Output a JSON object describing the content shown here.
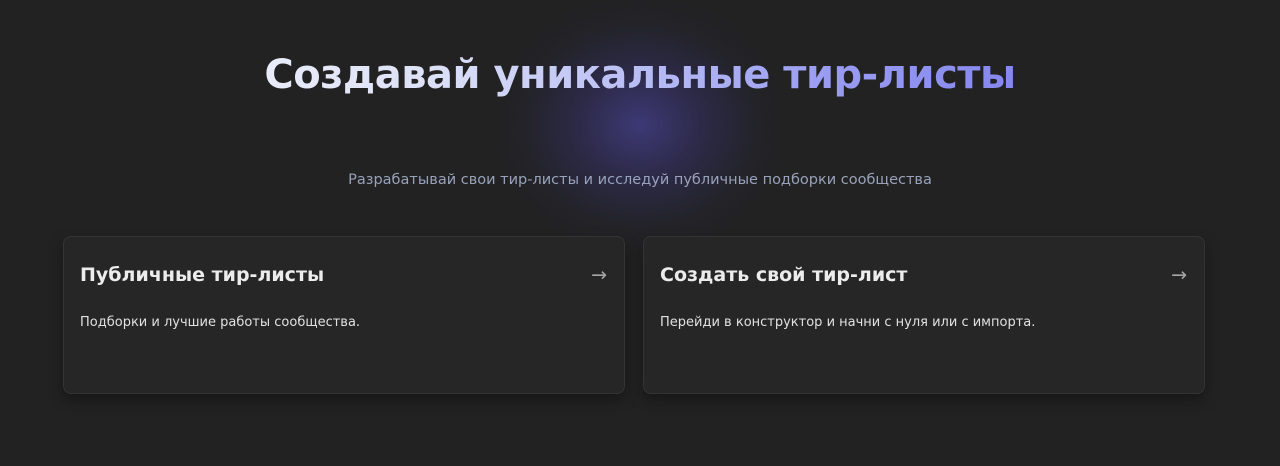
{
  "hero": {
    "title": "Создавай уникальные тир-листы",
    "subtitle": "Разрабатывай свои тир-листы и исследуй публичные подборки сообщества"
  },
  "cards": [
    {
      "title": "Публичные тир-листы",
      "description": "Подборки и лучшие работы сообщества.",
      "arrow": "→",
      "arrow_icon": "arrow-right-icon"
    },
    {
      "title": "Создать свой тир-лист",
      "description": "Перейди в конструктор и начни с нуля или с импорта.",
      "arrow": "→",
      "arrow_icon": "arrow-right-icon"
    }
  ],
  "colors": {
    "background": "#222222",
    "card_background": "#262626",
    "accent_glow": "#3e3a7a",
    "title_gradient_start": "#e9ecf8",
    "title_gradient_end": "#8587ef",
    "subtitle": "#98a2ba"
  }
}
